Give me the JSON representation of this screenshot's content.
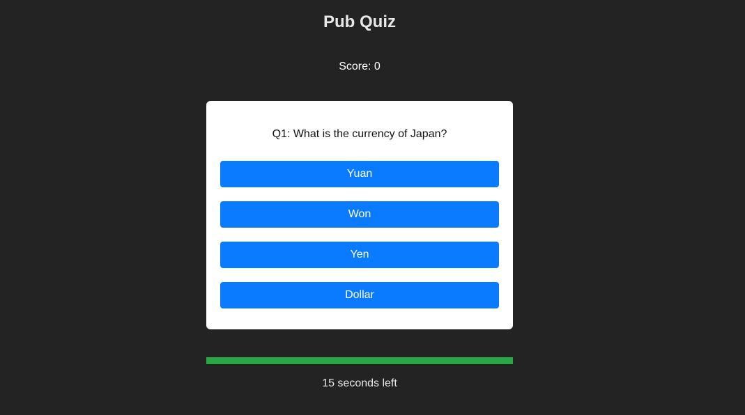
{
  "app": {
    "title": "Pub Quiz"
  },
  "score": {
    "text": "Score: 0"
  },
  "quiz": {
    "question": "Q1: What is the currency of Japan?",
    "answers": [
      "Yuan",
      "Won",
      "Yen",
      "Dollar"
    ]
  },
  "timer": {
    "progress_fraction": 1.0,
    "text": "15 seconds left"
  },
  "colors": {
    "background": "#232323",
    "card": "#ffffff",
    "answer_button": "#0a7aff",
    "progress": "#28a745"
  }
}
